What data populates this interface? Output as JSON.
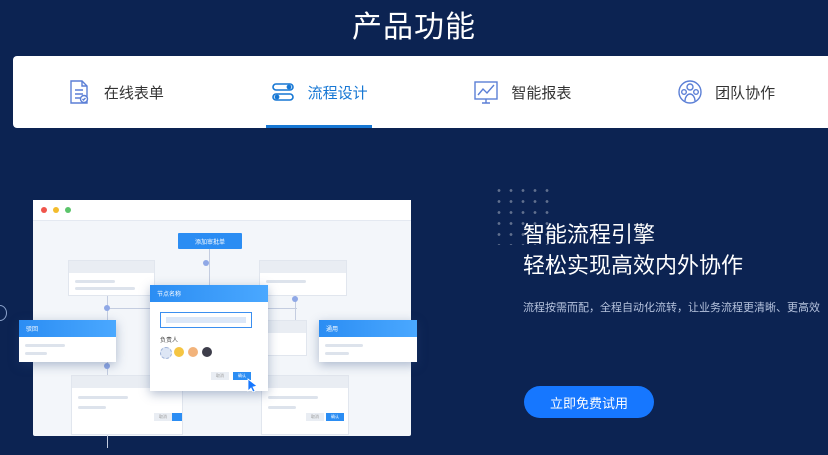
{
  "section": {
    "title": "产品功能"
  },
  "tabs": [
    {
      "label": "在线表单",
      "icon": "form-document-icon",
      "active": false
    },
    {
      "label": "流程设计",
      "icon": "workflow-toggle-icon",
      "active": true
    },
    {
      "label": "智能报表",
      "icon": "chart-report-icon",
      "active": false
    },
    {
      "label": "团队协作",
      "icon": "team-people-icon",
      "active": false
    }
  ],
  "feature": {
    "headline_line1": "智能流程引擎",
    "headline_line2": "轻松实现高效内外协作",
    "description": "流程按需而配，全程自动化流转，让业务流程更清晰、更高效",
    "cta_label": "立即免费试用"
  },
  "illustration": {
    "add_approver_button": "添加审批单",
    "node_card_title": "节点名称",
    "owner_label": "负责人",
    "left_card_title": "驳回",
    "right_card_title": "通用",
    "cancel_label": "取消",
    "confirm_label": "确认"
  },
  "colors": {
    "background": "#0c2352",
    "accent": "#1677d4",
    "cta": "#1677ff",
    "window_dots": [
      "#f0554b",
      "#f3bc2d",
      "#5bc46a"
    ]
  }
}
